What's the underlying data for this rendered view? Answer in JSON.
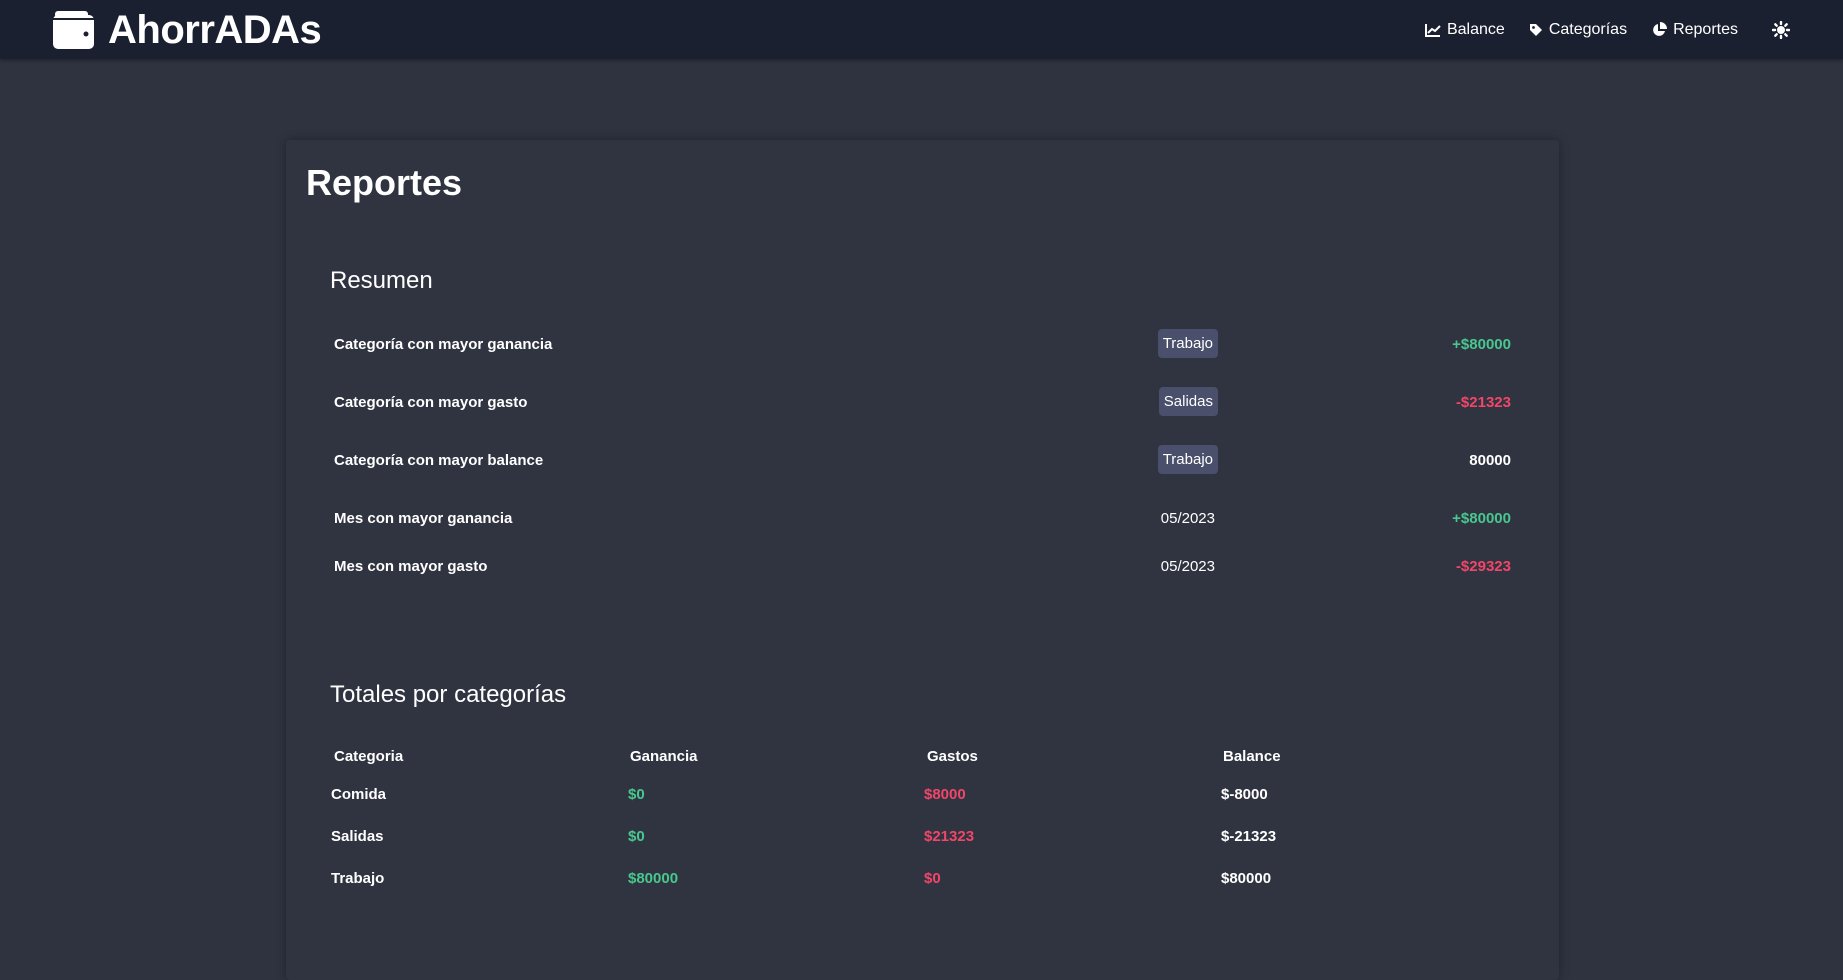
{
  "app": {
    "brand": "AhorrADAs"
  },
  "nav": {
    "balance": "Balance",
    "categorias": "Categorías",
    "reportes": "Reportes"
  },
  "page": {
    "title": "Reportes"
  },
  "resumen": {
    "title": "Resumen",
    "rows": [
      {
        "label": "Categoría con mayor ganancia",
        "tag": "Trabajo",
        "amount": "+$80000"
      },
      {
        "label": "Categoría con mayor gasto",
        "tag": "Salidas",
        "amount": "-$21323"
      },
      {
        "label": "Categoría con mayor balance",
        "tag": "Trabajo",
        "amount": "80000"
      },
      {
        "label": "Mes con mayor ganancia",
        "date": "05/2023",
        "amount": "+$80000"
      },
      {
        "label": "Mes con mayor gasto",
        "date": "05/2023",
        "amount": "-$29323"
      }
    ]
  },
  "totales": {
    "title": "Totales por categorías",
    "headers": [
      "Categoria",
      "Ganancia",
      "Gastos",
      "Balance"
    ],
    "rows": [
      {
        "categoria": "Comida",
        "ganancia": "$0",
        "gastos": "$8000",
        "balance": "$-8000"
      },
      {
        "categoria": "Salidas",
        "ganancia": "$0",
        "gastos": "$21323",
        "balance": "$-21323"
      },
      {
        "categoria": "Trabajo",
        "ganancia": "$80000",
        "gastos": "$0",
        "balance": "$80000"
      }
    ]
  },
  "colors": {
    "navbar": "#1b2030",
    "background": "#2f3340",
    "card": "#303441",
    "tag": "#4a4f6b",
    "positive": "#48c78e",
    "negative": "#f14668"
  },
  "icons": {
    "brand": "wallet-icon",
    "balance": "chart-line-icon",
    "categorias": "tag-icon",
    "reportes": "pie-chart-icon",
    "theme": "sun-icon"
  }
}
